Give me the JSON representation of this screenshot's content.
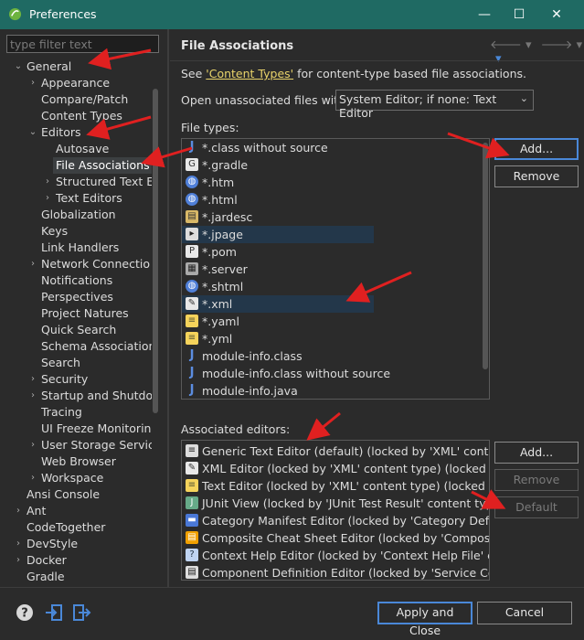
{
  "window": {
    "title": "Preferences",
    "minimize": "—",
    "maximize": "☐",
    "close": "✕"
  },
  "left": {
    "filter_placeholder": "type filter text",
    "tree": [
      {
        "label": "General",
        "tw": "⌄"
      },
      {
        "label": "Appearance",
        "tw": "›"
      },
      {
        "label": "Compare/Patch",
        "tw": ""
      },
      {
        "label": "Content Types",
        "tw": ""
      },
      {
        "label": "Editors",
        "tw": "⌄"
      },
      {
        "label": "Autosave",
        "tw": ""
      },
      {
        "label": "File Associations",
        "tw": ""
      },
      {
        "label": "Structured Text Ed",
        "tw": "›"
      },
      {
        "label": "Text Editors",
        "tw": "›"
      },
      {
        "label": "Globalization",
        "tw": ""
      },
      {
        "label": "Keys",
        "tw": ""
      },
      {
        "label": "Link Handlers",
        "tw": ""
      },
      {
        "label": "Network Connectio",
        "tw": "›"
      },
      {
        "label": "Notifications",
        "tw": ""
      },
      {
        "label": "Perspectives",
        "tw": ""
      },
      {
        "label": "Project Natures",
        "tw": ""
      },
      {
        "label": "Quick Search",
        "tw": ""
      },
      {
        "label": "Schema Associations",
        "tw": ""
      },
      {
        "label": "Search",
        "tw": ""
      },
      {
        "label": "Security",
        "tw": "›"
      },
      {
        "label": "Startup and Shutdo",
        "tw": "›"
      },
      {
        "label": "Tracing",
        "tw": ""
      },
      {
        "label": "UI Freeze Monitoring",
        "tw": ""
      },
      {
        "label": "User Storage Service",
        "tw": "›"
      },
      {
        "label": "Web Browser",
        "tw": ""
      },
      {
        "label": "Workspace",
        "tw": "›"
      },
      {
        "label": "Ansi Console",
        "tw": ""
      },
      {
        "label": "Ant",
        "tw": "›"
      },
      {
        "label": "CodeTogether",
        "tw": ""
      },
      {
        "label": "DevStyle",
        "tw": "›"
      },
      {
        "label": "Docker",
        "tw": "›"
      },
      {
        "label": "Gradle",
        "tw": ""
      }
    ]
  },
  "main": {
    "title": "File Associations",
    "see_prefix": "See ",
    "see_link": "'Content Types'",
    "see_suffix": " for content-type based file associations.",
    "open_label": "Open unassociated files with:",
    "open_value": "System Editor; if none: Text Editor",
    "file_types_label": "File types:",
    "file_types": [
      {
        "name": "*.class without source",
        "icon": "J"
      },
      {
        "name": "*.gradle",
        "icon": "G"
      },
      {
        "name": "*.htm",
        "icon": "◍"
      },
      {
        "name": "*.html",
        "icon": "◍"
      },
      {
        "name": "*.jardesc",
        "icon": "▤"
      },
      {
        "name": "*.jpage",
        "icon": "▸"
      },
      {
        "name": "*.pom",
        "icon": "P"
      },
      {
        "name": "*.server",
        "icon": "▦"
      },
      {
        "name": "*.shtml",
        "icon": "◍"
      },
      {
        "name": "*.xml",
        "icon": "✎"
      },
      {
        "name": "*.yaml",
        "icon": "≡"
      },
      {
        "name": "*.yml",
        "icon": "≡"
      },
      {
        "name": "module-info.class",
        "icon": "J"
      },
      {
        "name": "module-info.class without source",
        "icon": "J"
      },
      {
        "name": "module-info.java",
        "icon": "J"
      }
    ],
    "add_label": "Add...",
    "remove_label": "Remove",
    "assoc_label": "Associated editors:",
    "editors": [
      {
        "name": "Generic Text Editor (default) (locked by 'XML' content t",
        "icon": "≡"
      },
      {
        "name": "XML Editor (locked by 'XML' content type) (locked by 'X",
        "icon": "✎"
      },
      {
        "name": "Text Editor (locked by 'XML' content type) (locked by 'X",
        "icon": "≡"
      },
      {
        "name": "JUnit View (locked by 'JUnit Test Result' content type)",
        "icon": "J"
      },
      {
        "name": "Category Manifest Editor (locked by 'Category Definiti",
        "icon": "▬"
      },
      {
        "name": "Composite Cheat Sheet Editor (locked by 'Composite C",
        "icon": "▤"
      },
      {
        "name": "Context Help Editor (locked by 'Context Help File' conte",
        "icon": "?"
      },
      {
        "name": "Component Definition Editor (locked by 'Service Comp",
        "icon": "▤"
      }
    ],
    "ed_add_label": "Add...",
    "ed_remove_label": "Remove",
    "ed_default_label": "Default"
  },
  "footer": {
    "help": "?",
    "apply_close": "Apply and Close",
    "cancel": "Cancel"
  },
  "colors": {
    "titlebar": "#1f6a63",
    "background": "#2b2b2b",
    "link": "#e8d36a",
    "arrow": "#e02020",
    "default_button": "#4a88d8"
  }
}
